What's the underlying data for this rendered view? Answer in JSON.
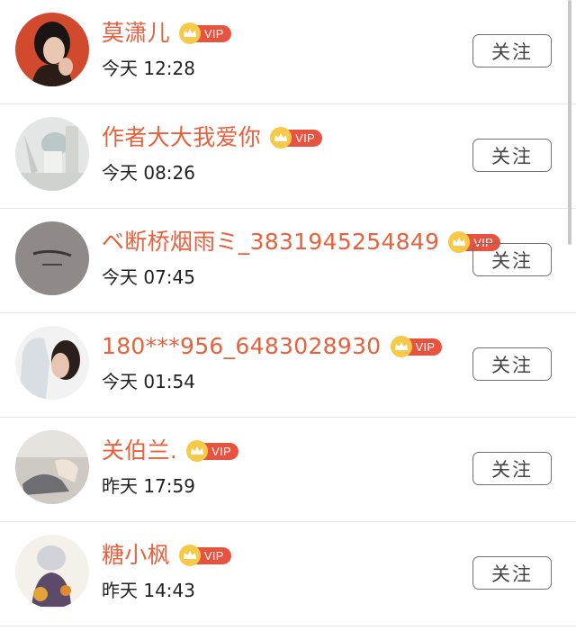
{
  "follow_button_label": "关注",
  "vip_label": "VIP",
  "colors": {
    "name": "#e8603c",
    "vip_badge": "#e8533f",
    "vip_crown": "#f7c948"
  },
  "users": [
    {
      "name": "莫潇儿",
      "time": "今天 12:28"
    },
    {
      "name": "作者大大我爱你",
      "time": "今天 08:26"
    },
    {
      "name": "ベ断桥烟雨ミ_3831945254849",
      "time": "今天 07:45"
    },
    {
      "name": "180***956_6483028930",
      "time": "今天 01:54"
    },
    {
      "name": "关伯兰.",
      "time": "昨天 17:59"
    },
    {
      "name": "糖小枫",
      "time": "昨天 14:43"
    }
  ]
}
